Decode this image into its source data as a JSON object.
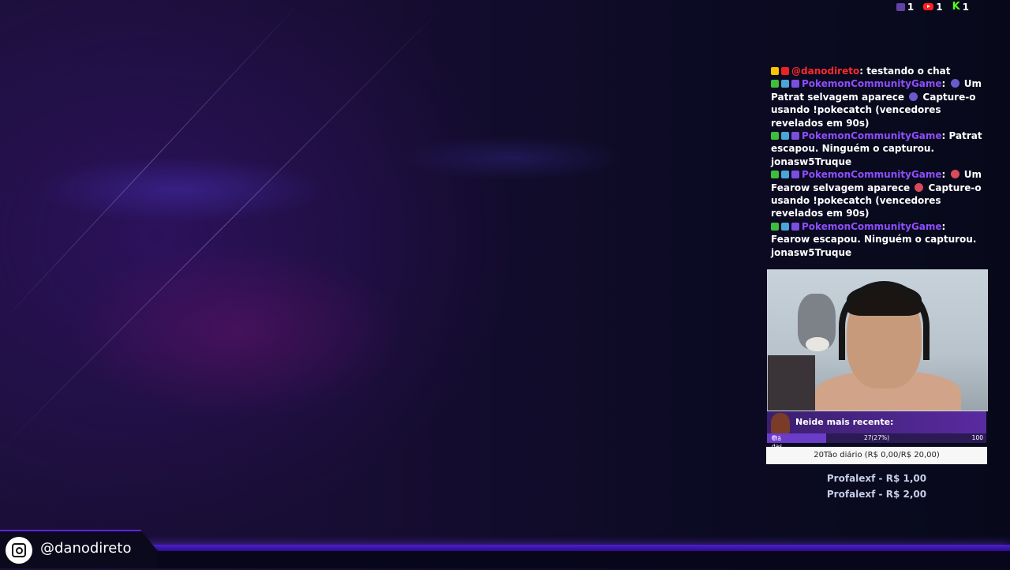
{
  "counters": [
    {
      "platform": "twitch",
      "icon": "twitch-icon",
      "value": "1"
    },
    {
      "platform": "youtube",
      "icon": "youtube-icon",
      "value": "1"
    },
    {
      "platform": "kick",
      "icon": "kick-icon",
      "value": "1",
      "glyph": "K"
    }
  ],
  "chat": {
    "messages": [
      {
        "user": "@danodireto",
        "text": ": testando o chat"
      },
      {
        "user": "PokemonCommunityGame",
        "pre": ": ",
        "mid": " Um Patrat selvagem aparece ",
        "post": " Capture-o usando !pokecatch (vencedores revelados em 90s)"
      },
      {
        "user": "PokemonCommunityGame",
        "text": ": Patrat escapou. Ninguém o capturou. jonasw5Truque"
      },
      {
        "user": "PokemonCommunityGame",
        "pre": ": ",
        "mid": " Um Fearow selvagem aparece ",
        "post": " Capture-o usando !pokecatch (vencedores revelados em 90s)"
      },
      {
        "user": "PokemonCommunityGame",
        "text": ": Fearow escapou. Ninguém o capturou. jonasw5Truque"
      }
    ]
  },
  "goal": {
    "title": "Neide mais recente:",
    "label": "Clã das Neides",
    "progress": "27(27%)",
    "max": "100",
    "fill_percent": 27
  },
  "daily_goal": "20Tão diário (R$ 0,00/R$ 20,00)",
  "donations": [
    "Profalexf - R$ 1,00",
    "Profalexf - R$ 2,00"
  ],
  "social": {
    "handle": "@danodireto",
    "icon": "instagram-icon"
  },
  "colors": {
    "accent": "#5a24e0",
    "twitch": "#8f4dff",
    "youtube": "#ff2a2a",
    "kick": "#53fc18"
  }
}
